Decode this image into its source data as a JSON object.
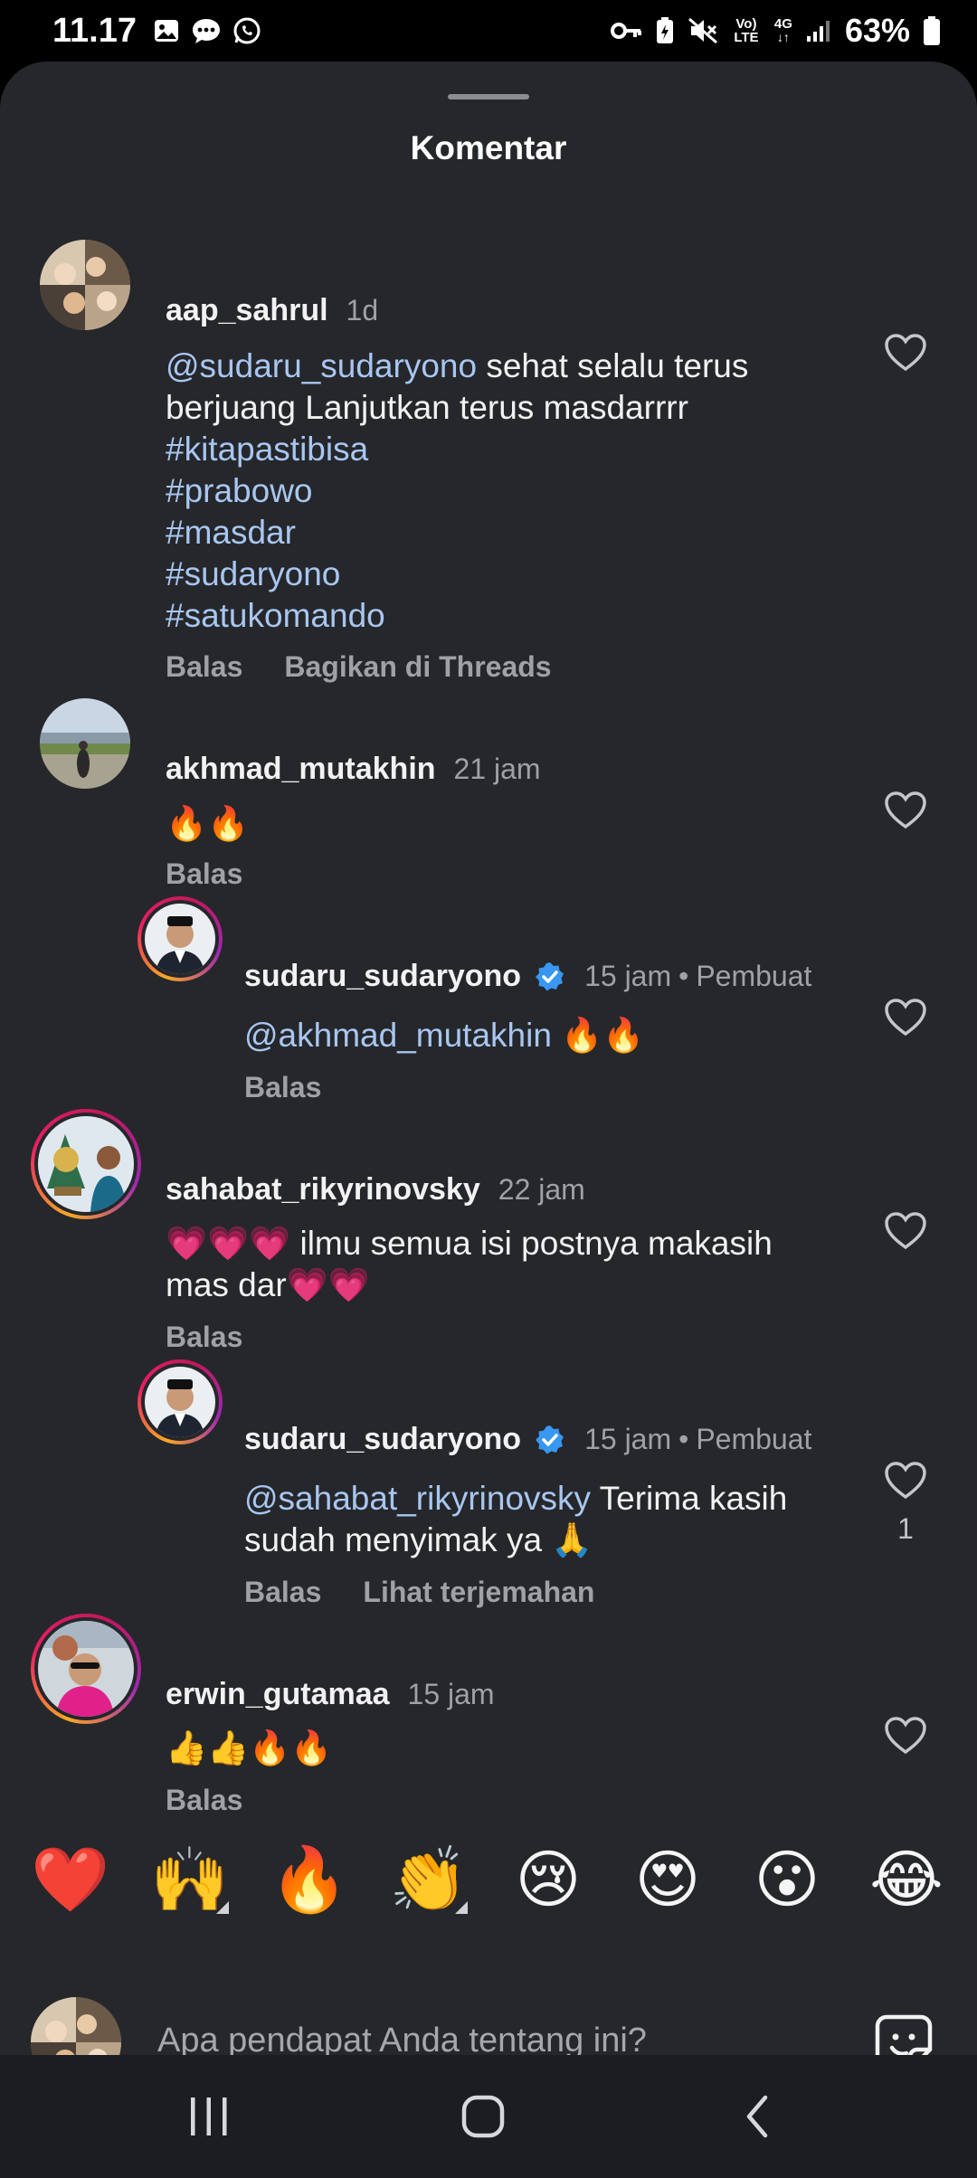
{
  "status_bar": {
    "time": "11.17",
    "battery_percent": "63%",
    "network": "4G",
    "volte": "Vo) LTE",
    "left_icons": [
      "gallery-icon",
      "message-icon",
      "whatsapp-icon"
    ],
    "right_icons": [
      "vpn-key-icon",
      "battery-saver-icon",
      "mute-icon",
      "volte-icon",
      "4g-icon",
      "signal-icon",
      "battery-icon"
    ]
  },
  "sheet": {
    "title": "Komentar"
  },
  "comments": [
    {
      "username": "aap_sahrul",
      "time": "1d",
      "mention": "@sudaru_sudaryono",
      "text": " sehat selalu terus berjuang Lanjutkan terus masdarrrr",
      "hashtags": [
        "#kitapastibisa",
        "#prabowo",
        "#masdar",
        "#sudaryono",
        "#satukomando"
      ],
      "actions": [
        "Balas",
        "Bagikan di Threads"
      ]
    },
    {
      "username": "akhmad_mutakhin",
      "time": "21 jam",
      "text": "🔥🔥",
      "actions": [
        "Balas"
      ]
    },
    {
      "username": "sudaru_sudaryono",
      "verified": true,
      "time": "15 jam",
      "creator_label": "Pembuat",
      "mention": "@akhmad_mutakhin",
      "text": " 🔥🔥",
      "actions": [
        "Balas"
      ]
    },
    {
      "username": "sahabat_rikyrinovsky",
      "time": "22 jam",
      "text": "💗💗💗 ilmu semua isi postnya makasih mas dar💗💗",
      "actions": [
        "Balas"
      ]
    },
    {
      "username": "sudaru_sudaryono",
      "verified": true,
      "time": "15 jam",
      "creator_label": "Pembuat",
      "mention": "@sahabat_rikyrinovsky",
      "text": " Terima kasih sudah menyimak ya 🙏",
      "actions": [
        "Balas",
        "Lihat terjemahan"
      ],
      "like_count": "1"
    },
    {
      "username": "erwin_gutamaa",
      "time": "15 jam",
      "text": "👍👍🔥🔥",
      "actions": [
        "Balas"
      ]
    }
  ],
  "reactions": [
    "❤️",
    "🙌",
    "🔥",
    "👏",
    "😢",
    "😍",
    "😮",
    "😂"
  ],
  "input": {
    "placeholder": "Apa pendapat Anda tentang ini?"
  },
  "nav": [
    "recent-apps",
    "home",
    "back"
  ],
  "colors": {
    "sheet_bg": "#25272b",
    "mention": "#a8c6f0",
    "secondary_text": "#9ea1a6",
    "verified": "#3897f0"
  }
}
